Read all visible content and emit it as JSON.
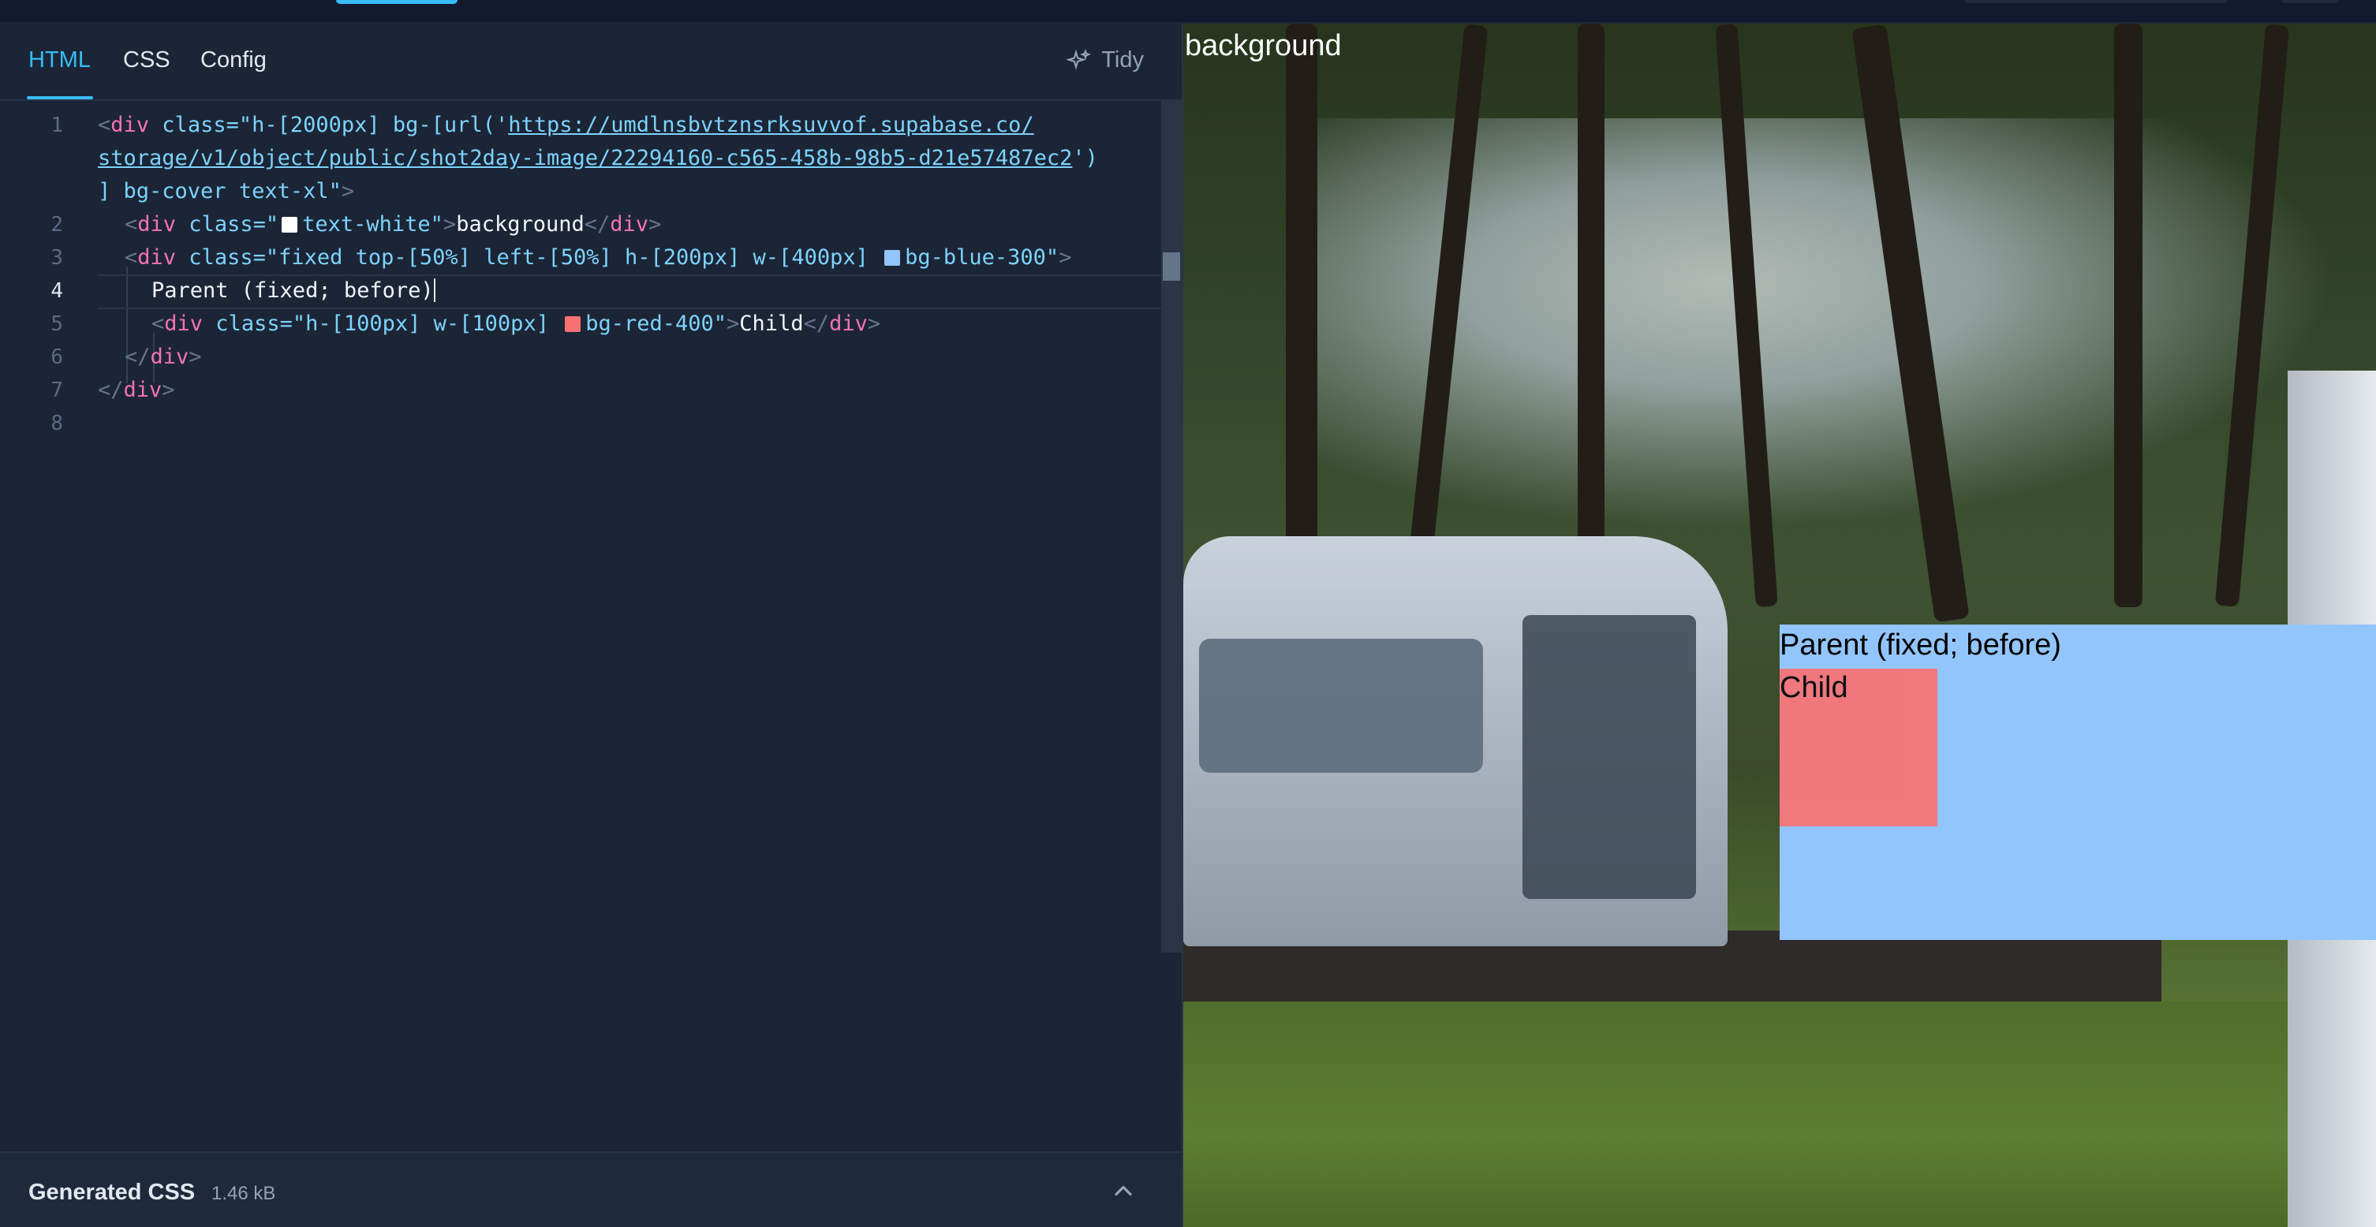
{
  "tabs": {
    "html": "HTML",
    "css": "CSS",
    "config": "Config"
  },
  "toolbar": {
    "tidy_label": "Tidy"
  },
  "editor": {
    "lines": [
      {
        "num": "1",
        "segments": [
          "<",
          "div",
          " class=",
          "\"h-[2000px] bg-[url('",
          "https://umdlnsbvtznsrksuvvof.supabase.co/",
          "storage/v1/object/public/shot2day-image/22294160-c565-458b-98b5-d21e57487ec2",
          "')",
          "] bg-cover text-xl\"",
          ">"
        ]
      },
      {
        "num": "2",
        "segments": [
          "<",
          "div",
          " class=",
          "\"",
          "text-white\"",
          ">",
          "background",
          "</",
          "div",
          ">"
        ]
      },
      {
        "num": "3",
        "segments": [
          "<",
          "div",
          " class=",
          "\"fixed top-[50%] left-[50%] h-[200px] w-[400px] ",
          "bg-blue-300\"",
          ">"
        ]
      },
      {
        "num": "4",
        "segments": [
          "Parent (fixed; before)"
        ]
      },
      {
        "num": "5",
        "segments": [
          "<",
          "div",
          " class=",
          "\"h-[100px] w-[100px] ",
          "bg-red-400\"",
          ">",
          "Child",
          "</",
          "div",
          ">"
        ]
      },
      {
        "num": "6",
        "segments": [
          "</",
          "div",
          ">"
        ]
      },
      {
        "num": "7",
        "segments": [
          "</",
          "div",
          ">"
        ]
      },
      {
        "num": "8",
        "segments": []
      }
    ]
  },
  "bottom_panel": {
    "title": "Generated CSS",
    "size": "1.46 kB"
  },
  "preview": {
    "background_text": "background",
    "parent_text": "Parent (fixed; before)",
    "child_text": "Child"
  },
  "colors": {
    "accent": "#38bdf8",
    "blue_300": "#93c5fd",
    "red_400": "#f87171",
    "white": "#ffffff"
  }
}
